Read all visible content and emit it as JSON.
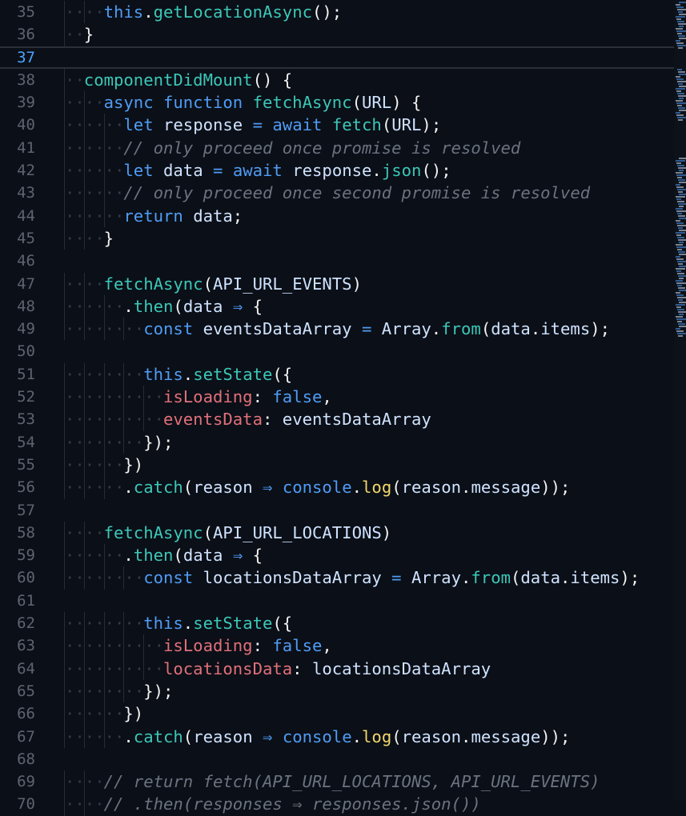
{
  "editor": {
    "current_line": 37,
    "lines": [
      {
        "n": "35",
        "indent": 2,
        "t": [
          [
            "kw",
            "this"
          ],
          [
            "pn",
            "."
          ],
          [
            "fn",
            "getLocationAsync"
          ],
          [
            "pn",
            "();"
          ]
        ]
      },
      {
        "n": "36",
        "indent": 1,
        "t": [
          [
            "pn",
            "}"
          ]
        ]
      },
      {
        "n": "37",
        "indent": 0,
        "t": []
      },
      {
        "n": "38",
        "indent": 1,
        "t": [
          [
            "fn",
            "componentDidMount"
          ],
          [
            "pn",
            "() {"
          ]
        ]
      },
      {
        "n": "39",
        "indent": 2,
        "t": [
          [
            "kw",
            "async function "
          ],
          [
            "fn",
            "fetchAsync"
          ],
          [
            "pn",
            "("
          ],
          [
            "var",
            "URL"
          ],
          [
            "pn",
            ") {"
          ]
        ]
      },
      {
        "n": "40",
        "indent": 3,
        "t": [
          [
            "kw",
            "let "
          ],
          [
            "var",
            "response "
          ],
          [
            "op",
            "= "
          ],
          [
            "kw",
            "await "
          ],
          [
            "fn",
            "fetch"
          ],
          [
            "pn",
            "("
          ],
          [
            "var",
            "URL"
          ],
          [
            "pn",
            ");"
          ]
        ]
      },
      {
        "n": "41",
        "indent": 3,
        "t": [
          [
            "cm",
            "// only proceed once promise is resolved"
          ]
        ]
      },
      {
        "n": "42",
        "indent": 3,
        "t": [
          [
            "kw",
            "let "
          ],
          [
            "var",
            "data "
          ],
          [
            "op",
            "= "
          ],
          [
            "kw",
            "await "
          ],
          [
            "var",
            "response"
          ],
          [
            "pn",
            "."
          ],
          [
            "fn",
            "json"
          ],
          [
            "pn",
            "();"
          ]
        ]
      },
      {
        "n": "43",
        "indent": 3,
        "t": [
          [
            "cm",
            "// only proceed once second promise is resolved"
          ]
        ]
      },
      {
        "n": "44",
        "indent": 3,
        "t": [
          [
            "kw",
            "return "
          ],
          [
            "var",
            "data"
          ],
          [
            "pn",
            ";"
          ]
        ]
      },
      {
        "n": "45",
        "indent": 2,
        "t": [
          [
            "pn",
            "}"
          ]
        ]
      },
      {
        "n": "46",
        "indent": 0,
        "t": []
      },
      {
        "n": "47",
        "indent": 2,
        "t": [
          [
            "fn",
            "fetchAsync"
          ],
          [
            "pn",
            "("
          ],
          [
            "var",
            "API_URL_EVENTS"
          ],
          [
            "pn",
            ")"
          ]
        ]
      },
      {
        "n": "48",
        "indent": 3,
        "t": [
          [
            "pn",
            "."
          ],
          [
            "fn",
            "then"
          ],
          [
            "pn",
            "("
          ],
          [
            "var",
            "data "
          ],
          [
            "op",
            "⇒ "
          ],
          [
            "pn",
            "{"
          ]
        ]
      },
      {
        "n": "49",
        "indent": 4,
        "t": [
          [
            "kw",
            "const "
          ],
          [
            "var",
            "eventsDataArray "
          ],
          [
            "op",
            "= "
          ],
          [
            "var",
            "Array"
          ],
          [
            "pn",
            "."
          ],
          [
            "fn",
            "from"
          ],
          [
            "pn",
            "("
          ],
          [
            "var",
            "data"
          ],
          [
            "pn",
            "."
          ],
          [
            "var",
            "items"
          ],
          [
            "pn",
            ");"
          ]
        ]
      },
      {
        "n": "50",
        "indent": 0,
        "t": []
      },
      {
        "n": "51",
        "indent": 4,
        "t": [
          [
            "kw",
            "this"
          ],
          [
            "pn",
            "."
          ],
          [
            "fn",
            "setState"
          ],
          [
            "pn",
            "({"
          ]
        ]
      },
      {
        "n": "52",
        "indent": 5,
        "t": [
          [
            "prop",
            "isLoading"
          ],
          [
            "pn",
            ": "
          ],
          [
            "kw",
            "false"
          ],
          [
            "pn",
            ","
          ]
        ]
      },
      {
        "n": "53",
        "indent": 5,
        "t": [
          [
            "prop",
            "eventsData"
          ],
          [
            "pn",
            ": "
          ],
          [
            "var",
            "eventsDataArray"
          ]
        ]
      },
      {
        "n": "54",
        "indent": 4,
        "t": [
          [
            "pn",
            "});"
          ]
        ]
      },
      {
        "n": "55",
        "indent": 3,
        "t": [
          [
            "pn",
            "})"
          ]
        ]
      },
      {
        "n": "56",
        "indent": 3,
        "t": [
          [
            "pn",
            "."
          ],
          [
            "fn",
            "catch"
          ],
          [
            "pn",
            "("
          ],
          [
            "var",
            "reason "
          ],
          [
            "op",
            "⇒ "
          ],
          [
            "kw",
            "console"
          ],
          [
            "pn",
            "."
          ],
          [
            "log",
            "log"
          ],
          [
            "pn",
            "("
          ],
          [
            "var",
            "reason"
          ],
          [
            "pn",
            "."
          ],
          [
            "var",
            "message"
          ],
          [
            "pn",
            "));"
          ]
        ]
      },
      {
        "n": "57",
        "indent": 0,
        "t": []
      },
      {
        "n": "58",
        "indent": 2,
        "t": [
          [
            "fn",
            "fetchAsync"
          ],
          [
            "pn",
            "("
          ],
          [
            "var",
            "API_URL_LOCATIONS"
          ],
          [
            "pn",
            ")"
          ]
        ]
      },
      {
        "n": "59",
        "indent": 3,
        "t": [
          [
            "pn",
            "."
          ],
          [
            "fn",
            "then"
          ],
          [
            "pn",
            "("
          ],
          [
            "var",
            "data "
          ],
          [
            "op",
            "⇒ "
          ],
          [
            "pn",
            "{"
          ]
        ]
      },
      {
        "n": "60",
        "indent": 4,
        "t": [
          [
            "kw",
            "const "
          ],
          [
            "var",
            "locationsDataArray "
          ],
          [
            "op",
            "= "
          ],
          [
            "var",
            "Array"
          ],
          [
            "pn",
            "."
          ],
          [
            "fn",
            "from"
          ],
          [
            "pn",
            "("
          ],
          [
            "var",
            "data"
          ],
          [
            "pn",
            "."
          ],
          [
            "var",
            "items"
          ],
          [
            "pn",
            ");"
          ]
        ]
      },
      {
        "n": "61",
        "indent": 0,
        "t": []
      },
      {
        "n": "62",
        "indent": 4,
        "t": [
          [
            "kw",
            "this"
          ],
          [
            "pn",
            "."
          ],
          [
            "fn",
            "setState"
          ],
          [
            "pn",
            "({"
          ]
        ]
      },
      {
        "n": "63",
        "indent": 5,
        "t": [
          [
            "prop",
            "isLoading"
          ],
          [
            "pn",
            ": "
          ],
          [
            "kw",
            "false"
          ],
          [
            "pn",
            ","
          ]
        ]
      },
      {
        "n": "64",
        "indent": 5,
        "t": [
          [
            "prop",
            "locationsData"
          ],
          [
            "pn",
            ": "
          ],
          [
            "var",
            "locationsDataArray"
          ]
        ]
      },
      {
        "n": "65",
        "indent": 4,
        "t": [
          [
            "pn",
            "});"
          ]
        ]
      },
      {
        "n": "66",
        "indent": 3,
        "t": [
          [
            "pn",
            "})"
          ]
        ]
      },
      {
        "n": "67",
        "indent": 3,
        "t": [
          [
            "pn",
            "."
          ],
          [
            "fn",
            "catch"
          ],
          [
            "pn",
            "("
          ],
          [
            "var",
            "reason "
          ],
          [
            "op",
            "⇒ "
          ],
          [
            "kw",
            "console"
          ],
          [
            "pn",
            "."
          ],
          [
            "log",
            "log"
          ],
          [
            "pn",
            "("
          ],
          [
            "var",
            "reason"
          ],
          [
            "pn",
            "."
          ],
          [
            "var",
            "message"
          ],
          [
            "pn",
            "));"
          ]
        ]
      },
      {
        "n": "68",
        "indent": 0,
        "t": []
      },
      {
        "n": "69",
        "indent": 2,
        "t": [
          [
            "cm",
            "// return fetch(API_URL_LOCATIONS, API_URL_EVENTS)"
          ]
        ]
      },
      {
        "n": "70",
        "indent": 2,
        "t": [
          [
            "cm",
            "// .then(responses ⇒ responses.json())"
          ]
        ]
      }
    ]
  },
  "colors": {
    "background": "#0b0f17",
    "keyword": "#4f9cf5",
    "function": "#3cc7b8",
    "property": "#e0707a",
    "comment": "#6b7280"
  }
}
